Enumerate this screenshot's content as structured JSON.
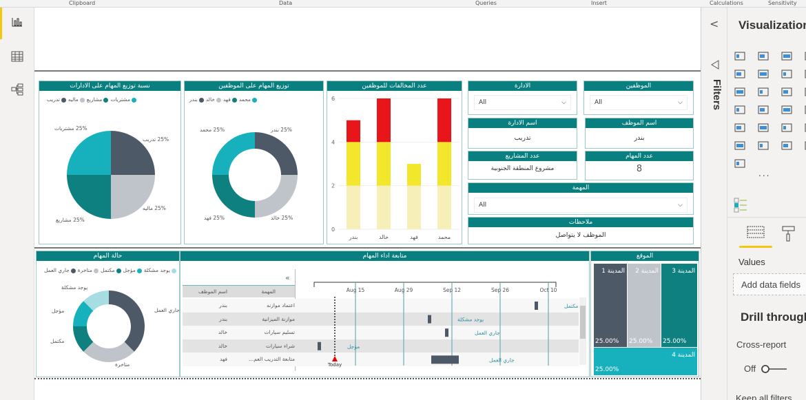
{
  "ribbon": {
    "groups": [
      "Clipboard",
      "Data",
      "Queries",
      "Insert",
      "Calculations",
      "Sensitivity"
    ]
  },
  "nav": {
    "items": [
      {
        "icon": "report-view-icon"
      },
      {
        "icon": "data-view-icon"
      },
      {
        "icon": "model-view-icon"
      }
    ]
  },
  "colors": {
    "header": "#0a7f7f",
    "dark": "#4e5968",
    "gray": "#bfc3ca",
    "teal": "#0e8080",
    "cyan": "#17b1bd",
    "lightcyan": "#a6dde3",
    "red": "#e8161b",
    "yellow": "#f2e72a",
    "paleyellow": "#f6efb8",
    "accent": "#f2c811"
  },
  "panels": {
    "dept_pie": {
      "title": "نسبة توزيع المهام على الادارات"
    },
    "emp_donut": {
      "title": "توزيع المهام على الموظفين"
    },
    "violations": {
      "title": "عدد المخالفات للموظفين"
    },
    "status": {
      "title": "حالة المهام"
    },
    "gantt": {
      "title": "متابعة اداء المهام",
      "collapse": "«",
      "col_task": "المهمة",
      "col_emp": "اسم الموظف",
      "today": "Today"
    },
    "location": {
      "title": "الموقع"
    }
  },
  "slicers": {
    "employees": {
      "title": "الموظفين",
      "value": "All"
    },
    "department": {
      "title": "الادارة",
      "value": "All"
    },
    "task": {
      "title": "المهمة",
      "value": "All"
    }
  },
  "cards": {
    "emp_name": {
      "title": "اسم الموظف",
      "value": "بندر"
    },
    "dept_name": {
      "title": "اسم الادارة",
      "value": "تدريب"
    },
    "task_count": {
      "title": "عدد المهام",
      "value": "8"
    },
    "project_count": {
      "title": "عدد المشاريع",
      "value": "مشروع المنطقة الجنوبية"
    },
    "notes": {
      "title": "ملاحظات",
      "value": "الموظف لا يتواصل"
    }
  },
  "chart_data": [
    {
      "type": "pie",
      "title": "نسبة توزيع المهام على الادارات",
      "legend": "top",
      "slices": [
        {
          "name": "تدريب",
          "value": 25,
          "label": "25% تدريب"
        },
        {
          "name": "ماليه",
          "value": 25,
          "label": "25% ماليه"
        },
        {
          "name": "مشاريع",
          "value": 25,
          "label": "25% مشاريع"
        },
        {
          "name": "مشتريات",
          "value": 25,
          "label": "25% مشتريات"
        }
      ]
    },
    {
      "type": "pie",
      "donut": true,
      "title": "توزيع المهام على الموظفين",
      "legend": "top",
      "slices": [
        {
          "name": "بندر",
          "value": 25,
          "label": "25% بندر"
        },
        {
          "name": "خالد",
          "value": 25,
          "label": "25% خالد"
        },
        {
          "name": "فهد",
          "value": 25,
          "label": "25% فهد"
        },
        {
          "name": "محمد",
          "value": 25,
          "label": "25% محمد"
        }
      ]
    },
    {
      "type": "bar",
      "stacked": true,
      "title": "عدد المخالفات للموظفين",
      "categories": [
        "بندر",
        "خالد",
        "فهد",
        "محمد"
      ],
      "ylim": [
        0,
        6
      ],
      "yticks": [
        0,
        2,
        4,
        6
      ],
      "grid": true,
      "series": [
        {
          "values": [
            2,
            2,
            2,
            2
          ]
        },
        {
          "values": [
            2,
            2,
            1,
            2
          ]
        },
        {
          "values": [
            1,
            2,
            0,
            2
          ]
        }
      ]
    },
    {
      "type": "pie",
      "donut": true,
      "title": "حالة المهام",
      "legend": "top",
      "slices": [
        {
          "name": "جاري العمل",
          "value": 3,
          "label": "جاري العمل"
        },
        {
          "name": "متاخرة",
          "value": 2,
          "label": "متاخرة"
        },
        {
          "name": "مكتمل",
          "value": 1,
          "label": "مكتمل"
        },
        {
          "name": "مؤجل",
          "value": 1,
          "label": "مؤجل"
        },
        {
          "name": "يوجد مشكلة",
          "value": 1,
          "label": "يوجد مشكلة"
        }
      ]
    },
    {
      "type": "gantt",
      "title": "متابعة اداء المهام",
      "xticks": [
        "Aug 15",
        "Aug 29",
        "Sep 12",
        "Sep 26",
        "Oct 10"
      ],
      "today": "Aug 9",
      "rows": [
        {
          "task": "اعتماد موازنه",
          "employee": "بندر",
          "start": "Oct 6",
          "end": "Oct 7",
          "status": "مكتمل"
        },
        {
          "task": "موازنة الميزانية",
          "employee": "بندر",
          "start": "Sep 5",
          "end": "Sep 6",
          "status": "يوجد مشكلة"
        },
        {
          "task": "تسليم سيارات",
          "employee": "خالد",
          "start": "Sep 10",
          "end": "Sep 11",
          "status": "جاري العمل"
        },
        {
          "task": "شراء سيارات",
          "employee": "خالد",
          "start": "Aug 4",
          "end": "Aug 5",
          "status": "مؤجل"
        },
        {
          "task": "متابعة التدريب العم...",
          "employee": "فهد",
          "start": "Sep 6",
          "end": "Sep 14",
          "status": "جاري العمل"
        }
      ]
    },
    {
      "type": "treemap",
      "title": "الموقع",
      "items": [
        {
          "name": "المدينة 1",
          "value": "25.00%"
        },
        {
          "name": "المدينة 2",
          "value": "25.00%"
        },
        {
          "name": "المدينة 3",
          "value": "25.00%"
        },
        {
          "name": "المدينة 4",
          "value": "25.00%"
        }
      ]
    }
  ],
  "filters_pane": {
    "label": "Filters",
    "collapse": "<"
  },
  "viz_pane": {
    "title": "Visualizations",
    "more": "...",
    "values_label": "Values",
    "add_fields": "Add data fields",
    "drill_title": "Drill through",
    "cross_report": "Cross-report",
    "toggle_state": "Off",
    "keep_filters": "Keep all filters"
  }
}
